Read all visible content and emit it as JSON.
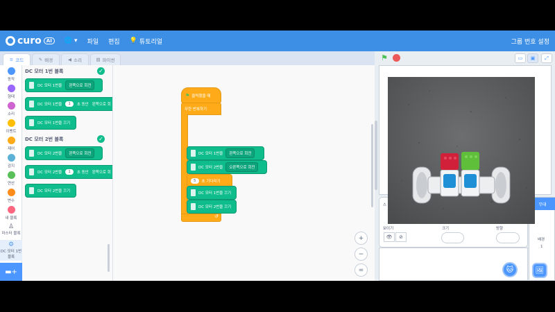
{
  "menubar": {
    "logo": "curo",
    "logo_badge": "AI",
    "file": "파일",
    "edit": "편집",
    "tutorial": "튜토리얼",
    "right": "그룹 번호 설정"
  },
  "tabs": [
    {
      "label": "코드"
    },
    {
      "label": "배경"
    },
    {
      "label": "소리"
    },
    {
      "label": "파이썬"
    }
  ],
  "categories": [
    {
      "label": "동작",
      "color": "#4c97ff"
    },
    {
      "label": "형태",
      "color": "#9966ff"
    },
    {
      "label": "소리",
      "color": "#cf63cf"
    },
    {
      "label": "이벤트",
      "color": "#ffbf00"
    },
    {
      "label": "제어",
      "color": "#ffab19"
    },
    {
      "label": "감지",
      "color": "#5cb1d6"
    },
    {
      "label": "연산",
      "color": "#59c059"
    },
    {
      "label": "변수",
      "color": "#ff8c1a"
    },
    {
      "label": "내 블록",
      "color": "#ff6680"
    },
    {
      "label": "마스터 블록"
    },
    {
      "label": "DC 모터 1번 블록"
    }
  ],
  "flyout": {
    "section1": "DC 모터 1번 블록",
    "section2": "DC 모터 2번 블록",
    "m1_rotate": "DC 모터 1번을",
    "m1_dir": "왼쪽으로 회전",
    "m1_for": "초 동안",
    "m1_dir2": "왼쪽으로 회",
    "m1_stop": "DC 모터 1번을 끄기",
    "m2_rotate": "DC 모터 2번을",
    "m2_dir": "왼쪽으로 회전",
    "m2_for": "초 동안",
    "m2_dir2": "왼쪽으로 회",
    "m2_stop": "DC 모터 2번을 끄기",
    "num1": "1",
    "num2": "1"
  },
  "script": {
    "hat": "클릭했을 때",
    "forever": "무한 반복하기",
    "m1": "DC 모터 1번을",
    "m1_dir": "왼쪽으로 회전",
    "m2": "DC 모터 2번을",
    "m2_dir": "오른쪽으로 회전",
    "wait_num": "5",
    "wait": "초 기다리기",
    "m1_stop": "DC 모터 1번을 끄기",
    "m2_stop": "DC 모터 2번을 끄기",
    "loop_arrow": "↺"
  },
  "zoom": {
    "in": "+",
    "out": "−",
    "reset": "="
  },
  "sprite_info": {
    "sprite_label": "스",
    "show": "보이기",
    "size": "크기",
    "direction": "방향"
  },
  "stage_panel": {
    "title": "무대",
    "backdrops": "배경",
    "count": "1"
  }
}
